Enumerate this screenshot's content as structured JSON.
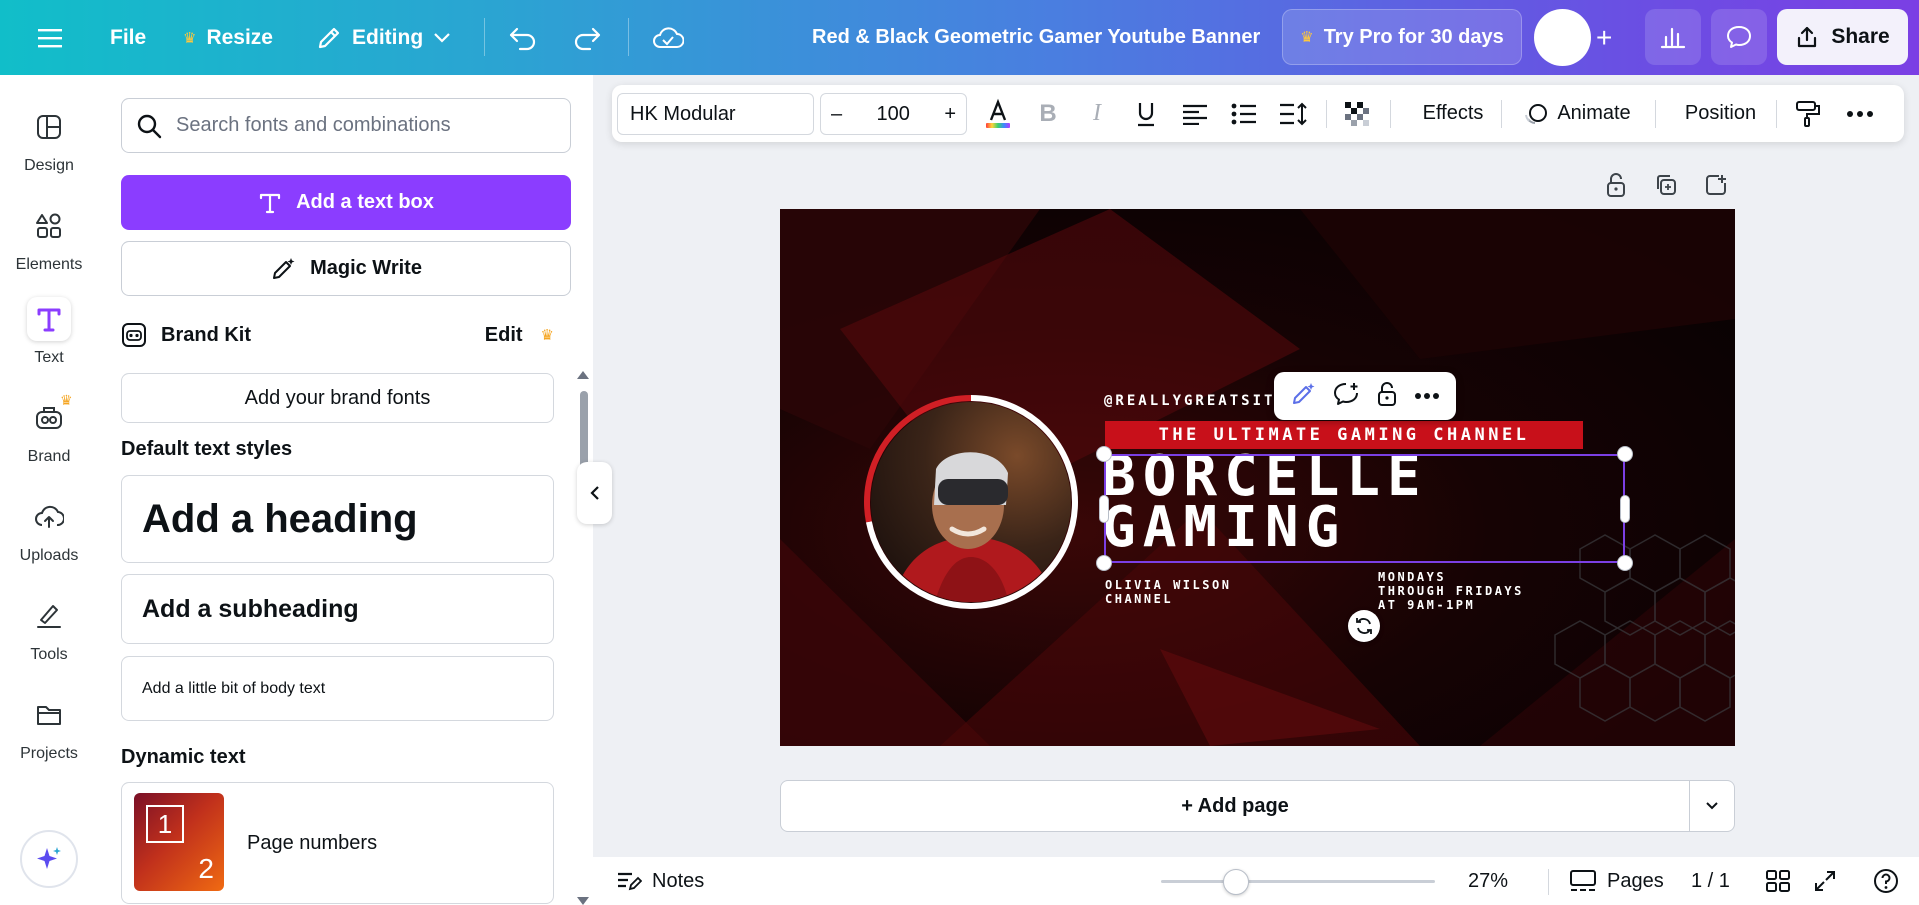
{
  "topbar": {
    "file_label": "File",
    "resize_label": "Resize",
    "editing_label": "Editing",
    "doc_title": "Red & Black Geometric Gamer Youtube Banner",
    "try_pro_label": "Try Pro for 30 days",
    "share_label": "Share"
  },
  "rail": {
    "items": [
      {
        "label": "Design",
        "icon": "layout-icon"
      },
      {
        "label": "Elements",
        "icon": "shapes-icon"
      },
      {
        "label": "Text",
        "icon": "text-icon"
      },
      {
        "label": "Brand",
        "icon": "brand-icon"
      },
      {
        "label": "Uploads",
        "icon": "cloud-upload-icon"
      },
      {
        "label": "Tools",
        "icon": "pen-tool-icon"
      },
      {
        "label": "Projects",
        "icon": "folder-icon"
      }
    ],
    "active": "Text"
  },
  "panel": {
    "search_placeholder": "Search fonts and combinations",
    "add_textbox_label": "Add a text box",
    "magic_write_label": "Magic Write",
    "brand_kit_label": "Brand Kit",
    "brand_edit_label": "Edit",
    "add_brand_fonts_label": "Add your brand fonts",
    "default_styles_title": "Default text styles",
    "heading_label": "Add a heading",
    "subheading_label": "Add a subheading",
    "body_label": "Add a little bit of body text",
    "dynamic_title": "Dynamic text",
    "page_numbers_label": "Page numbers",
    "page_num_thumb_1": "1",
    "page_num_thumb_2": "2"
  },
  "format_bar": {
    "font_name": "HK Modular",
    "font_size": "100",
    "decrease": "–",
    "increase": "+",
    "effects_label": "Effects",
    "animate_label": "Animate",
    "position_label": "Position"
  },
  "design": {
    "handle": "@REALLYGREATSITE",
    "tagline": "THE ULTIMATE GAMING CHANNEL",
    "title_line1": "BORCELLE",
    "title_line2": "GAMING",
    "owner_line1": "OLIVIA WILSON",
    "owner_line2": "CHANNEL",
    "schedule_line1": "MONDAYS",
    "schedule_line2": "THROUGH FRIDAYS",
    "schedule_line3": "AT 9AM-1PM"
  },
  "canvas": {
    "add_page_label": "+ Add page"
  },
  "bottom": {
    "notes_label": "Notes",
    "zoom_label": "27%",
    "zoom_value": 0.27,
    "pages_label": "Pages",
    "page_count": "1 / 1"
  },
  "colors": {
    "accent_purple": "#8b3dff",
    "banner_red": "#c8101a",
    "selection_purple": "#7b3fe4"
  }
}
